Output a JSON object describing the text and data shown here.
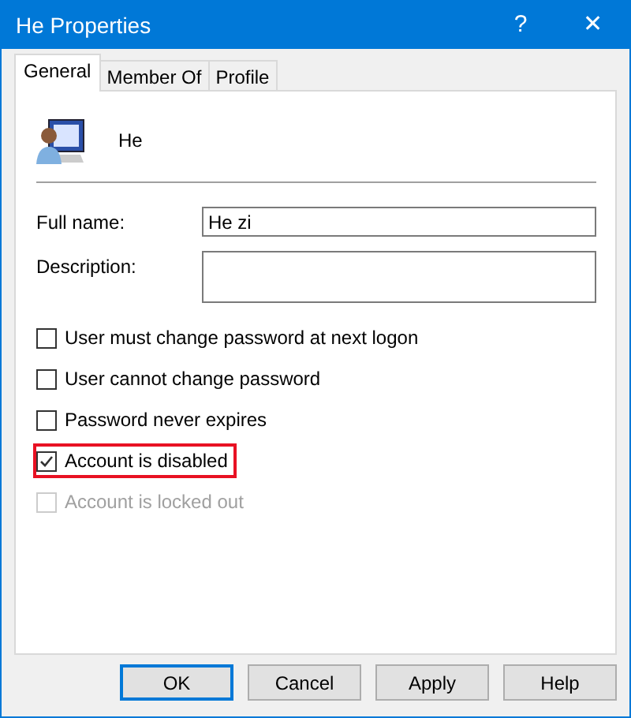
{
  "window": {
    "title": "He Properties",
    "help": "?",
    "close": "✕"
  },
  "tabs": [
    {
      "label": "General",
      "selected": true
    },
    {
      "label": "Member Of",
      "selected": false
    },
    {
      "label": "Profile",
      "selected": false
    }
  ],
  "user": {
    "name": "He"
  },
  "fields": [
    {
      "label": "Full name:",
      "value": "He zi",
      "kind": "single"
    },
    {
      "label": "Description:",
      "kind": "multi"
    }
  ],
  "options": [
    {
      "label": "User must change password at next logon",
      "checked": false,
      "disabled": false,
      "highlighted": false
    },
    {
      "label": "User cannot change password",
      "checked": false,
      "disabled": false,
      "highlighted": false
    },
    {
      "label": "Password never expires",
      "checked": false,
      "disabled": false,
      "highlighted": false
    },
    {
      "label": "Account is disabled",
      "checked": true,
      "disabled": false,
      "highlighted": true
    },
    {
      "label": "Account is locked out",
      "checked": false,
      "disabled": true,
      "highlighted": false
    }
  ],
  "buttons": [
    {
      "label": "OK",
      "default": true
    },
    {
      "label": "Cancel",
      "default": false
    },
    {
      "label": "Apply",
      "default": false
    },
    {
      "label": "Help",
      "default": false
    }
  ]
}
